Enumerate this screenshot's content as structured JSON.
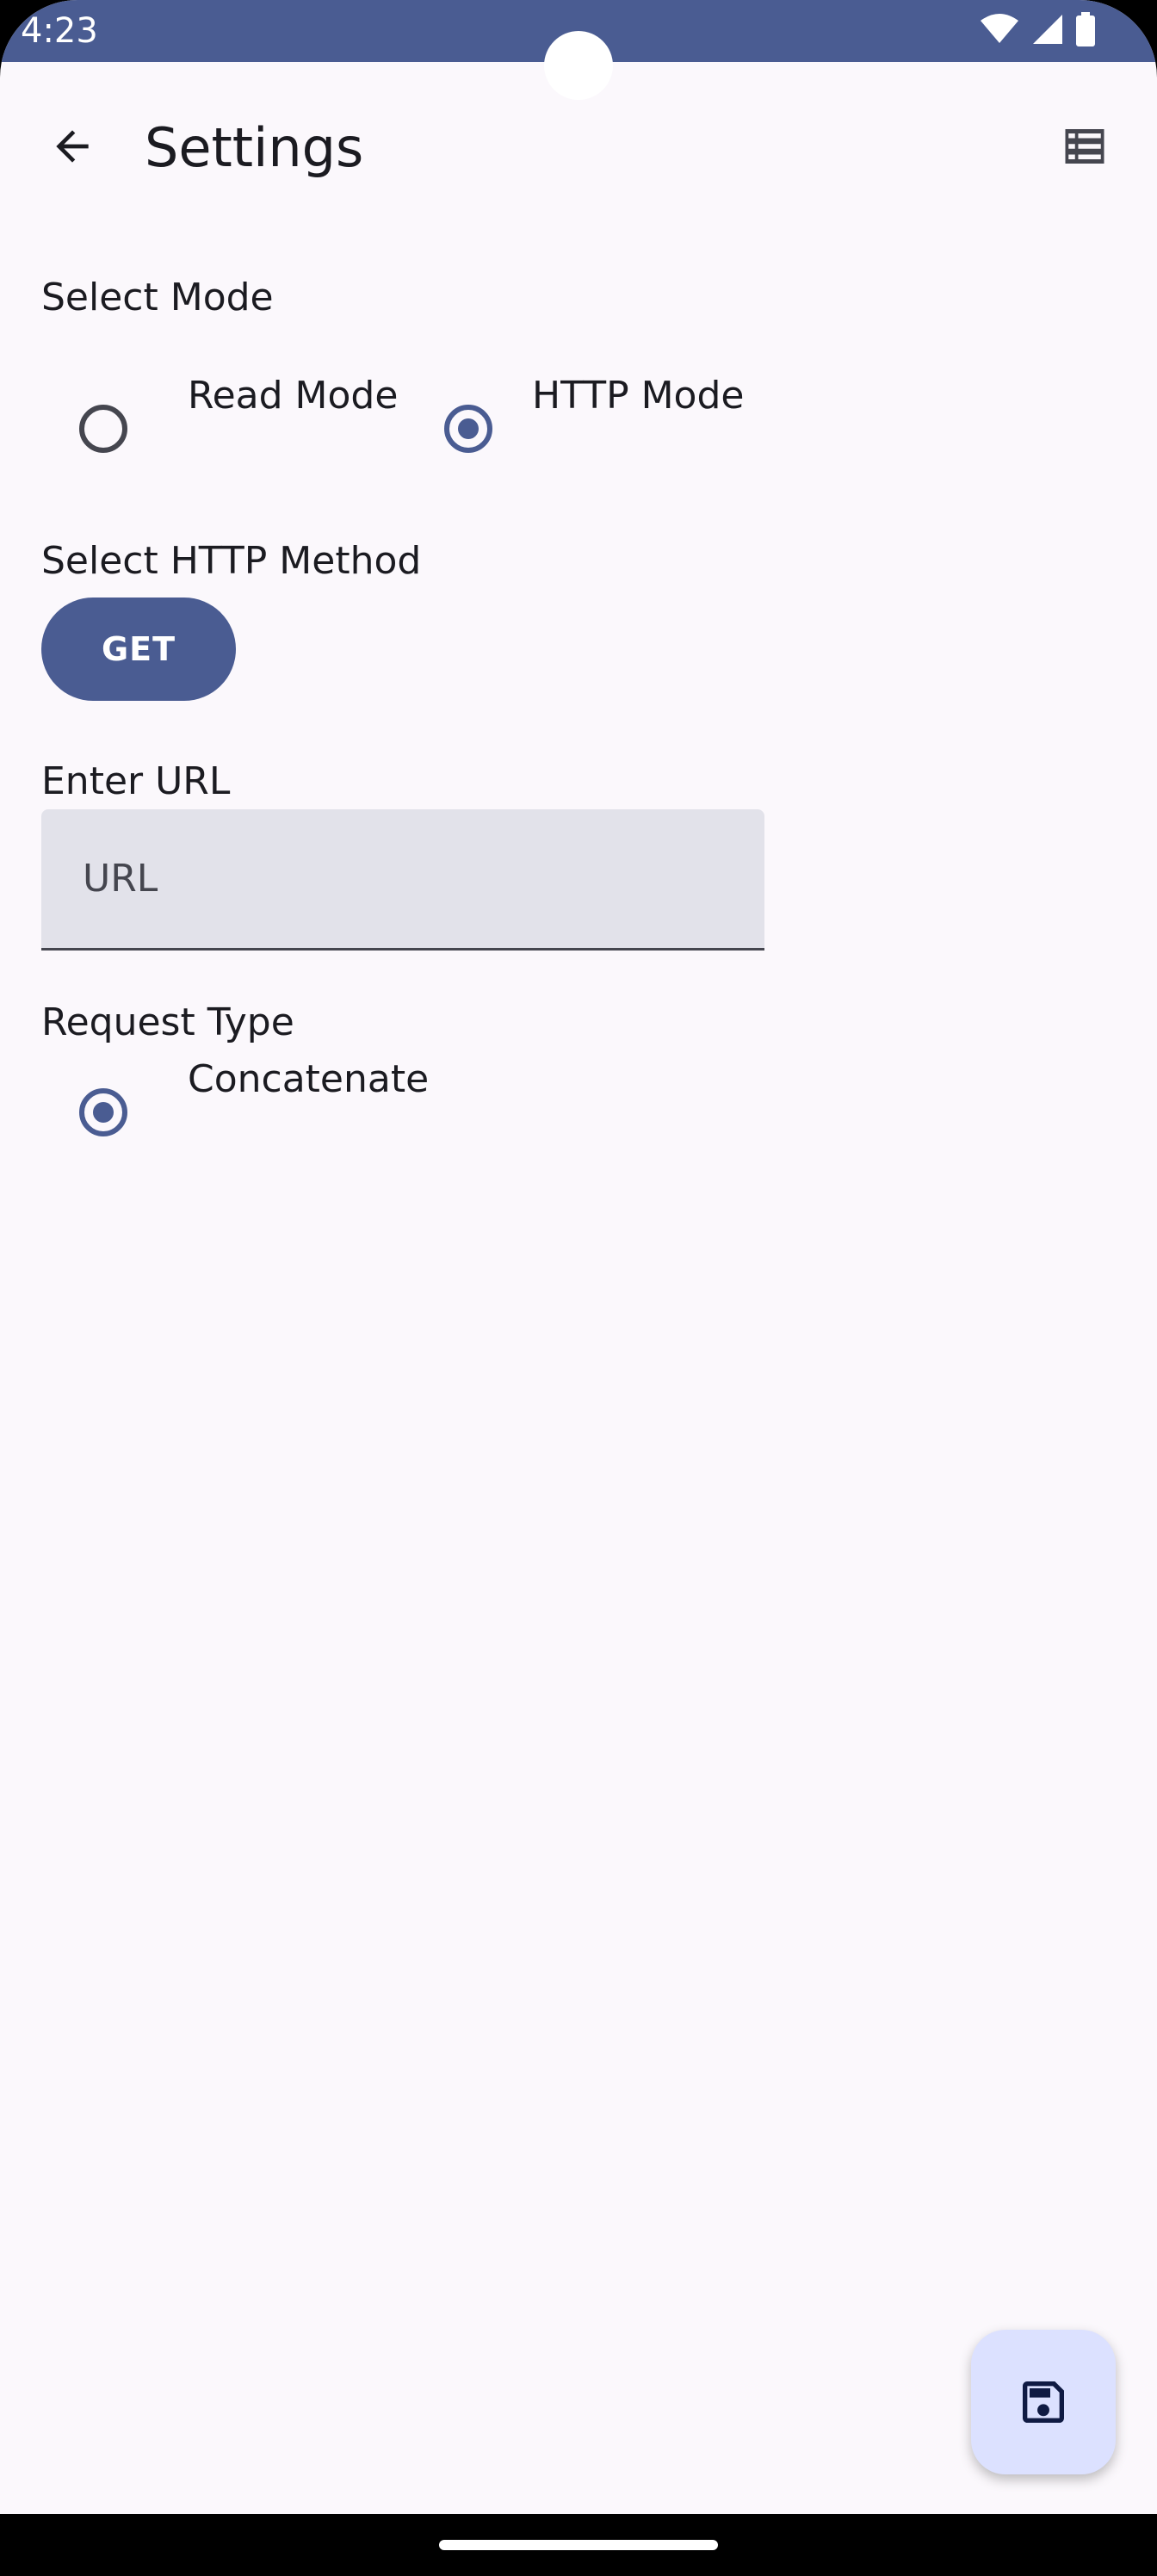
{
  "status_bar": {
    "time": "4:23",
    "icons": [
      "wifi-icon",
      "signal-icon",
      "battery-icon"
    ],
    "color": "#4a5c92"
  },
  "app_bar": {
    "title": "Settings",
    "back_icon": "arrow-back-icon",
    "action_icon": "list-icon"
  },
  "mode": {
    "label": "Select Mode",
    "options": [
      {
        "label": "Read Mode",
        "selected": false
      },
      {
        "label": "HTTP Mode",
        "selected": true
      }
    ]
  },
  "http_method": {
    "label": "Select HTTP Method",
    "value": "GET"
  },
  "url": {
    "label": "Enter URL",
    "placeholder": "URL",
    "value": ""
  },
  "request_type": {
    "label": "Request Type",
    "options": [
      {
        "label": "Concatenate",
        "selected": true
      }
    ]
  },
  "fab": {
    "icon": "save-icon"
  },
  "colors": {
    "primary": "#4a5c92",
    "background": "#fbf8fc",
    "field": "#e2e2ea",
    "fab": "#dce1ff"
  }
}
